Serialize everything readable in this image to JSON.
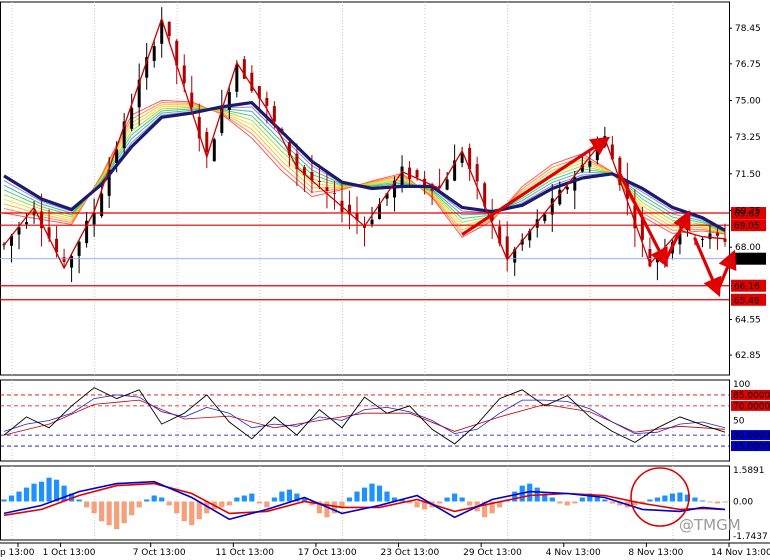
{
  "chart_data": {
    "type": "line",
    "price_panel": {
      "ylim": [
        61.9,
        79.7
      ],
      "y_ticks": [
        "78.45",
        "76.75",
        "75.00",
        "73.25",
        "71.50",
        "69.75",
        "68.00",
        "66.16",
        "64.55",
        "62.85"
      ],
      "horizontal_levels": [
        {
          "label": "69.63",
          "value": 69.63,
          "color": "#e00000",
          "label_bg": "#e00000"
        },
        {
          "label": "69.05",
          "value": 69.05,
          "color": "#e00000",
          "label_bg": "#e00000"
        },
        {
          "label": "67.45",
          "value": 67.45,
          "color": "#8aa6ff",
          "label_bg": "#000000"
        },
        {
          "label": "66.16",
          "value": 66.16,
          "color": "#e00000",
          "label_bg": "#e00000"
        },
        {
          "label": "65.49",
          "value": 65.49,
          "color": "#e00000",
          "label_bg": "#e00000"
        }
      ],
      "zigzag": [
        [
          0,
          68.1
        ],
        [
          4,
          69.9
        ],
        [
          8,
          67.0
        ],
        [
          12,
          69.7
        ],
        [
          21,
          78.9
        ],
        [
          27,
          72.3
        ],
        [
          31,
          76.8
        ],
        [
          35,
          74.6
        ],
        [
          39,
          71.8
        ],
        [
          48,
          69.0
        ],
        [
          53,
          71.6
        ],
        [
          58,
          70.8
        ],
        [
          61,
          72.6
        ],
        [
          67,
          67.4
        ],
        [
          80,
          73.2
        ],
        [
          86,
          67.2
        ],
        [
          90,
          68.8
        ],
        [
          93,
          68.5
        ],
        [
          96,
          68.4
        ]
      ],
      "slow_ma": [
        [
          0,
          71.4
        ],
        [
          5,
          70.3
        ],
        [
          9,
          69.8
        ],
        [
          13,
          71.0
        ],
        [
          17,
          72.8
        ],
        [
          21,
          74.2
        ],
        [
          25,
          74.4
        ],
        [
          29,
          74.7
        ],
        [
          33,
          74.9
        ],
        [
          37,
          73.5
        ],
        [
          41,
          72.1
        ],
        [
          45,
          71.1
        ],
        [
          49,
          70.8
        ],
        [
          53,
          70.9
        ],
        [
          57,
          70.9
        ],
        [
          61,
          69.9
        ],
        [
          65,
          69.7
        ],
        [
          69,
          70.0
        ],
        [
          73,
          70.8
        ],
        [
          77,
          71.3
        ],
        [
          81,
          71.5
        ],
        [
          85,
          70.8
        ],
        [
          89,
          69.9
        ],
        [
          93,
          69.4
        ],
        [
          96,
          68.8
        ]
      ],
      "fast_ma": [
        [
          0,
          69.4
        ],
        [
          5,
          69.2
        ],
        [
          9,
          69.0
        ],
        [
          13,
          71.5
        ],
        [
          17,
          74.5
        ],
        [
          21,
          75.1
        ],
        [
          25,
          75.0
        ],
        [
          29,
          74.3
        ],
        [
          33,
          73.0
        ],
        [
          37,
          71.4
        ],
        [
          41,
          70.2
        ],
        [
          45,
          70.7
        ],
        [
          49,
          71.2
        ],
        [
          53,
          71.6
        ],
        [
          57,
          70.3
        ],
        [
          61,
          68.3
        ],
        [
          65,
          69.2
        ],
        [
          69,
          71.0
        ],
        [
          73,
          72.1
        ],
        [
          77,
          72.6
        ],
        [
          81,
          71.6
        ],
        [
          85,
          69.3
        ],
        [
          89,
          68.5
        ],
        [
          93,
          68.7
        ],
        [
          96,
          68.6
        ]
      ],
      "arrows": [
        {
          "from": [
            61,
            68.6
          ],
          "to": [
            80,
            73.1
          ]
        },
        {
          "from": [
            82,
            71.5
          ],
          "to": [
            88,
            67.3
          ]
        },
        {
          "from": [
            88,
            67.3
          ],
          "to": [
            91,
            69.5
          ]
        },
        {
          "from": [
            92,
            68.4
          ],
          "to": [
            95,
            65.9
          ]
        },
        {
          "from": [
            95,
            65.9
          ],
          "to": [
            97,
            67.6
          ]
        }
      ]
    },
    "stoch_panel": {
      "ylim": [
        0,
        100
      ],
      "y_ticks": [
        "100",
        "50",
        "0"
      ],
      "levels": [
        {
          "label": "85.0000",
          "value": 85,
          "color": "#e00000"
        },
        {
          "label": "70.0000",
          "value": 70,
          "color": "#e00000"
        },
        {
          "label": "30.0000",
          "value": 30,
          "color": "#0000cc"
        },
        {
          "label": "15.0000",
          "value": 15,
          "color": "#0000cc"
        }
      ],
      "main_line": [
        [
          0,
          30
        ],
        [
          3,
          55
        ],
        [
          6,
          40
        ],
        [
          9,
          70
        ],
        [
          12,
          95
        ],
        [
          15,
          80
        ],
        [
          18,
          92
        ],
        [
          21,
          45
        ],
        [
          24,
          60
        ],
        [
          27,
          85
        ],
        [
          30,
          48
        ],
        [
          33,
          25
        ],
        [
          36,
          55
        ],
        [
          39,
          30
        ],
        [
          42,
          65
        ],
        [
          45,
          40
        ],
        [
          48,
          82
        ],
        [
          51,
          60
        ],
        [
          54,
          70
        ],
        [
          57,
          38
        ],
        [
          60,
          18
        ],
        [
          63,
          45
        ],
        [
          66,
          80
        ],
        [
          69,
          92
        ],
        [
          72,
          70
        ],
        [
          75,
          84
        ],
        [
          78,
          55
        ],
        [
          81,
          35
        ],
        [
          84,
          20
        ],
        [
          87,
          40
        ],
        [
          90,
          55
        ],
        [
          93,
          44
        ],
        [
          96,
          34
        ]
      ],
      "signal_line": [
        [
          0,
          35
        ],
        [
          3,
          45
        ],
        [
          6,
          50
        ],
        [
          9,
          60
        ],
        [
          12,
          80
        ],
        [
          15,
          85
        ],
        [
          18,
          82
        ],
        [
          21,
          62
        ],
        [
          24,
          55
        ],
        [
          27,
          68
        ],
        [
          30,
          60
        ],
        [
          33,
          40
        ],
        [
          36,
          45
        ],
        [
          39,
          42
        ],
        [
          42,
          55
        ],
        [
          45,
          50
        ],
        [
          48,
          65
        ],
        [
          51,
          68
        ],
        [
          54,
          62
        ],
        [
          57,
          50
        ],
        [
          60,
          32
        ],
        [
          63,
          38
        ],
        [
          66,
          60
        ],
        [
          69,
          78
        ],
        [
          72,
          78
        ],
        [
          75,
          76
        ],
        [
          78,
          66
        ],
        [
          81,
          48
        ],
        [
          84,
          32
        ],
        [
          87,
          34
        ],
        [
          90,
          45
        ],
        [
          93,
          48
        ],
        [
          96,
          40
        ]
      ],
      "third_line": [
        [
          0,
          30
        ],
        [
          6,
          45
        ],
        [
          12,
          72
        ],
        [
          18,
          78
        ],
        [
          24,
          52
        ],
        [
          30,
          56
        ],
        [
          36,
          40
        ],
        [
          42,
          50
        ],
        [
          48,
          60
        ],
        [
          54,
          60
        ],
        [
          60,
          35
        ],
        [
          66,
          55
        ],
        [
          72,
          72
        ],
        [
          78,
          62
        ],
        [
          84,
          34
        ],
        [
          90,
          42
        ],
        [
          96,
          38
        ]
      ]
    },
    "macd_panel": {
      "y_ticks": [
        "1.5891",
        "0.00",
        "-1.7437"
      ],
      "ylim": [
        -1.7437,
        1.5891
      ],
      "histogram": [
        0.1,
        0.3,
        0.5,
        0.7,
        0.9,
        1.0,
        1.2,
        1.1,
        0.8,
        0.4,
        0.1,
        -0.3,
        -0.6,
        -1.0,
        -1.2,
        -1.4,
        -1.1,
        -0.7,
        -0.3,
        0.1,
        0.3,
        0.2,
        -0.2,
        -0.6,
        -1.0,
        -1.2,
        -0.9,
        -0.6,
        -0.4,
        -0.3,
        -0.2,
        0.2,
        0.3,
        0.4,
        -0.1,
        -0.3,
        0.2,
        0.5,
        0.6,
        0.4,
        0.2,
        -0.2,
        -0.6,
        -0.8,
        -0.6,
        -0.3,
        0.2,
        0.5,
        0.7,
        0.9,
        0.8,
        0.5,
        0.2,
        0.1,
        -0.1,
        -0.3,
        -0.4,
        -0.3,
        -0.1,
        0.2,
        0.4,
        0.2,
        -0.2,
        -0.5,
        -0.8,
        -0.6,
        -0.3,
        0.1,
        0.5,
        0.8,
        0.9,
        0.7,
        0.4,
        0.2,
        -0.1,
        -0.2,
        -0.1,
        0.2,
        0.4,
        0.3,
        0.1,
        -0.1,
        -0.2,
        -0.3,
        -0.2,
        -0.1,
        0.1,
        0.2,
        0.3,
        0.4,
        0.45,
        0.35,
        0.2,
        0.05,
        -0.05,
        -0.1,
        -0.05
      ],
      "macd_line": [
        [
          0,
          -0.6
        ],
        [
          5,
          -0.2
        ],
        [
          10,
          0.5
        ],
        [
          15,
          0.9
        ],
        [
          20,
          1.0
        ],
        [
          25,
          0.2
        ],
        [
          30,
          -0.9
        ],
        [
          35,
          -0.4
        ],
        [
          40,
          0.2
        ],
        [
          45,
          -0.6
        ],
        [
          50,
          -0.2
        ],
        [
          55,
          0.3
        ],
        [
          60,
          -0.8
        ],
        [
          65,
          0.1
        ],
        [
          70,
          0.5
        ],
        [
          75,
          0.4
        ],
        [
          80,
          0.2
        ],
        [
          85,
          -0.4
        ],
        [
          90,
          -0.5
        ],
        [
          93,
          -0.3
        ],
        [
          96,
          -0.4
        ]
      ],
      "signal_line": [
        [
          0,
          -0.7
        ],
        [
          5,
          -0.4
        ],
        [
          10,
          0.3
        ],
        [
          15,
          0.8
        ],
        [
          20,
          0.9
        ],
        [
          25,
          0.4
        ],
        [
          30,
          -0.6
        ],
        [
          35,
          -0.5
        ],
        [
          40,
          0.0
        ],
        [
          45,
          -0.3
        ],
        [
          50,
          -0.3
        ],
        [
          55,
          0.1
        ],
        [
          60,
          -0.5
        ],
        [
          65,
          -0.1
        ],
        [
          70,
          0.3
        ],
        [
          75,
          0.4
        ],
        [
          80,
          0.3
        ],
        [
          85,
          -0.1
        ],
        [
          90,
          -0.4
        ],
        [
          93,
          -0.35
        ],
        [
          96,
          -0.4
        ]
      ],
      "watermark": "@TMGM"
    },
    "x_ticks": [
      {
        "label": "p 13:00",
        "i": 0
      },
      {
        "label": "1 Oct 13:00",
        "i": 7
      },
      {
        "label": "7 Oct 13:00",
        "i": 19
      },
      {
        "label": "11 Oct 13:00",
        "i": 30
      },
      {
        "label": "17 Oct 13:00",
        "i": 41
      },
      {
        "label": "23 Oct 13:00",
        "i": 52
      },
      {
        "label": "29 Oct 13:00",
        "i": 63
      },
      {
        "label": "4 Nov 13:00",
        "i": 74
      },
      {
        "label": "8 Nov 13:00",
        "i": 85
      },
      {
        "label": "14 Nov 13:00",
        "i": 96
      }
    ],
    "colors": {
      "up": "#000000",
      "down": "#b00000",
      "slow_ma": "#1a1a6e",
      "fast_ma": "#202080",
      "zigzag": "#d00000",
      "arrow": "#e00000",
      "hist_up": "#1e90ff",
      "hist_down": "#f4a07a",
      "macd": "#0000cc",
      "macd_signal": "#e00000"
    }
  }
}
